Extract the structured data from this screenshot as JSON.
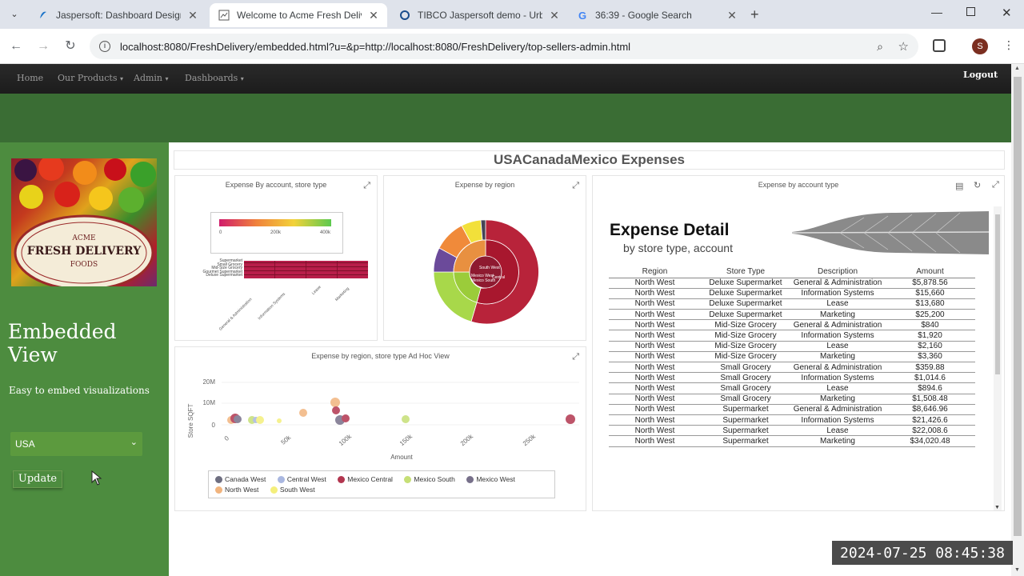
{
  "browser": {
    "tabs": [
      {
        "title": "Jaspersoft: Dashboard Designer",
        "icon": "jaspersoft-icon"
      },
      {
        "title": "Welcome to Acme Fresh Delivery",
        "icon": "page-icon"
      },
      {
        "title": "TIBCO Jaspersoft demo - Urban",
        "icon": "tibco-icon"
      },
      {
        "title": "36:39 - Google Search",
        "icon": "google-icon"
      }
    ],
    "url": "localhost:8080/FreshDelivery/embedded.html?u=&p=http://localhost:8080/FreshDelivery/top-sellers-admin.html",
    "profile_initial": "S"
  },
  "nav": {
    "items": [
      "Home",
      "Our Products",
      "Admin",
      "Dashboards"
    ],
    "logout": "Logout"
  },
  "sidebar": {
    "logo_top": "ACME",
    "logo_main": "FRESH DELIVERY",
    "logo_sub": "FOODS",
    "heading": "Embedded View",
    "subtext": "Easy to embed visualizations",
    "country": "USA",
    "update": "Update"
  },
  "dashboard": {
    "title": "USACanadaMexico Expenses",
    "panel1_title": "Expense By account, store type",
    "panel1_scale": [
      "0",
      "200k",
      "400k"
    ],
    "panel1_rows": [
      "Supermarket",
      "Small Grocery",
      "Mid-Size Grocery",
      "Gourmet Supermarket",
      "Deluxe Supermarket"
    ],
    "panel1_cols": [
      "General & Administration",
      "Information Systems",
      "Lease",
      "Marketing"
    ],
    "panel2_title": "Expense by region",
    "panel2_labels": [
      "South West",
      "Mexico West",
      "Mexico South",
      "Central"
    ],
    "panel3_title": "Expense by account type",
    "panel4_title": "Expense by region, store type Ad Hoc View",
    "panel4_ylabel": "Store SQFT",
    "panel4_xlabel": "Amount",
    "panel4_yticks": [
      "20M",
      "10M",
      "0"
    ],
    "panel4_xticks": [
      "0",
      "50k",
      "100k",
      "150k",
      "200k",
      "250k"
    ],
    "legend": [
      {
        "name": "Canada West",
        "color": "#6e6e80"
      },
      {
        "name": "Central West",
        "color": "#a9b7e0"
      },
      {
        "name": "Mexico Central",
        "color": "#b2364f"
      },
      {
        "name": "Mexico South",
        "color": "#c6df76"
      },
      {
        "name": "Mexico West",
        "color": "#77708a"
      },
      {
        "name": "North West",
        "color": "#f1b47e"
      },
      {
        "name": "South West",
        "color": "#f4ef7c"
      }
    ]
  },
  "report": {
    "title": "Expense Detail",
    "subtitle": "by store type, account",
    "headers": [
      "Region",
      "Store Type",
      "Description",
      "Amount"
    ],
    "rows": [
      [
        "North West",
        "Deluxe Supermarket",
        "General & Administration",
        "$5,878.56"
      ],
      [
        "North West",
        "Deluxe Supermarket",
        "Information Systems",
        "$15,660"
      ],
      [
        "North West",
        "Deluxe Supermarket",
        "Lease",
        "$13,680"
      ],
      [
        "North West",
        "Deluxe Supermarket",
        "Marketing",
        "$25,200"
      ],
      [
        "North West",
        "Mid-Size Grocery",
        "General & Administration",
        "$840"
      ],
      [
        "North West",
        "Mid-Size Grocery",
        "Information Systems",
        "$1,920"
      ],
      [
        "North West",
        "Mid-Size Grocery",
        "Lease",
        "$2,160"
      ],
      [
        "North West",
        "Mid-Size Grocery",
        "Marketing",
        "$3,360"
      ],
      [
        "North West",
        "Small Grocery",
        "General & Administration",
        "$359.88"
      ],
      [
        "North West",
        "Small Grocery",
        "Information Systems",
        "$1,014.6"
      ],
      [
        "North West",
        "Small Grocery",
        "Lease",
        "$894.6"
      ],
      [
        "North West",
        "Small Grocery",
        "Marketing",
        "$1,508.48"
      ],
      [
        "North West",
        "Supermarket",
        "General & Administration",
        "$8,646.96"
      ],
      [
        "North West",
        "Supermarket",
        "Information Systems",
        "$21,426.6"
      ],
      [
        "North West",
        "Supermarket",
        "Lease",
        "$22,008.6"
      ],
      [
        "North West",
        "Supermarket",
        "Marketing",
        "$34,020.48"
      ]
    ]
  },
  "timestamp": "2024-07-25 08:45:38"
}
